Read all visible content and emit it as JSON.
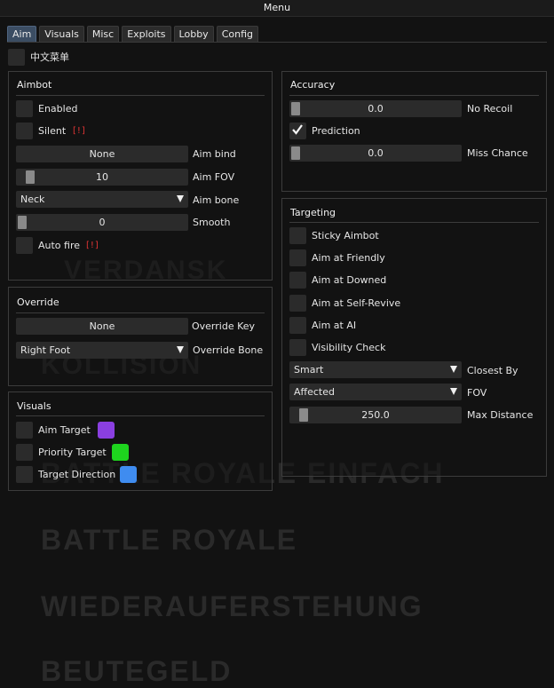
{
  "window": {
    "title": "Menu"
  },
  "background_text": [
    "VERDANSK",
    "KOLLISION",
    "BATTLE ROYALE EINFACH",
    "BATTLE ROYALE",
    "WIEDERAUFERSTEHUNG",
    "BEUTEGELD"
  ],
  "tabs": [
    {
      "label": "Aim",
      "active": true
    },
    {
      "label": "Visuals"
    },
    {
      "label": "Misc"
    },
    {
      "label": "Exploits"
    },
    {
      "label": "Lobby"
    },
    {
      "label": "Config"
    }
  ],
  "language_toggle": {
    "label": "中文菜单",
    "checked": false
  },
  "aimbot": {
    "title": "Aimbot",
    "enabled_label": "Enabled",
    "silent_label": "Silent",
    "silent_warning": "[!]",
    "aim_bind": {
      "value": "None",
      "label": "Aim bind"
    },
    "aim_fov": {
      "value": "10",
      "label": "Aim FOV",
      "fill": 0.05
    },
    "aim_bone": {
      "value": "Neck",
      "label": "Aim bone"
    },
    "smooth": {
      "value": "0",
      "label": "Smooth",
      "fill": 0.0
    },
    "auto_fire_label": "Auto fire",
    "auto_fire_warning": "[!]"
  },
  "override": {
    "title": "Override",
    "key": {
      "value": "None",
      "label": "Override Key"
    },
    "bone": {
      "value": "Right Foot",
      "label": "Override Bone"
    }
  },
  "visuals": {
    "title": "Visuals",
    "aim_target": {
      "label": "Aim Target",
      "color": "#8a3fe0"
    },
    "priority_target": {
      "label": "Priority Target",
      "color": "#1ed41e"
    },
    "target_direction": {
      "label": "Target Direction",
      "color": "#3f8cf0"
    }
  },
  "accuracy": {
    "title": "Accuracy",
    "no_recoil": {
      "value": "0.0",
      "label": "No Recoil",
      "fill": 0.0
    },
    "prediction_label": "Prediction",
    "prediction_checked": true,
    "miss_chance": {
      "value": "0.0",
      "label": "Miss Chance",
      "fill": 0.0
    }
  },
  "targeting": {
    "title": "Targeting",
    "options": [
      "Sticky Aimbot",
      "Aim at Friendly",
      "Aim at Downed",
      "Aim at Self-Revive",
      "Aim at AI",
      "Visibility Check"
    ],
    "closest_by": {
      "value": "Smart",
      "label": "Closest By"
    },
    "fov": {
      "value": "Affected",
      "label": "FOV"
    },
    "max_distance": {
      "value": "250.0",
      "label": "Max Distance",
      "fill": 0.05
    }
  },
  "colors": {
    "accent_tab": "#3b4d63",
    "warning": "#e03535",
    "control_bg": "#2b2b2b"
  }
}
